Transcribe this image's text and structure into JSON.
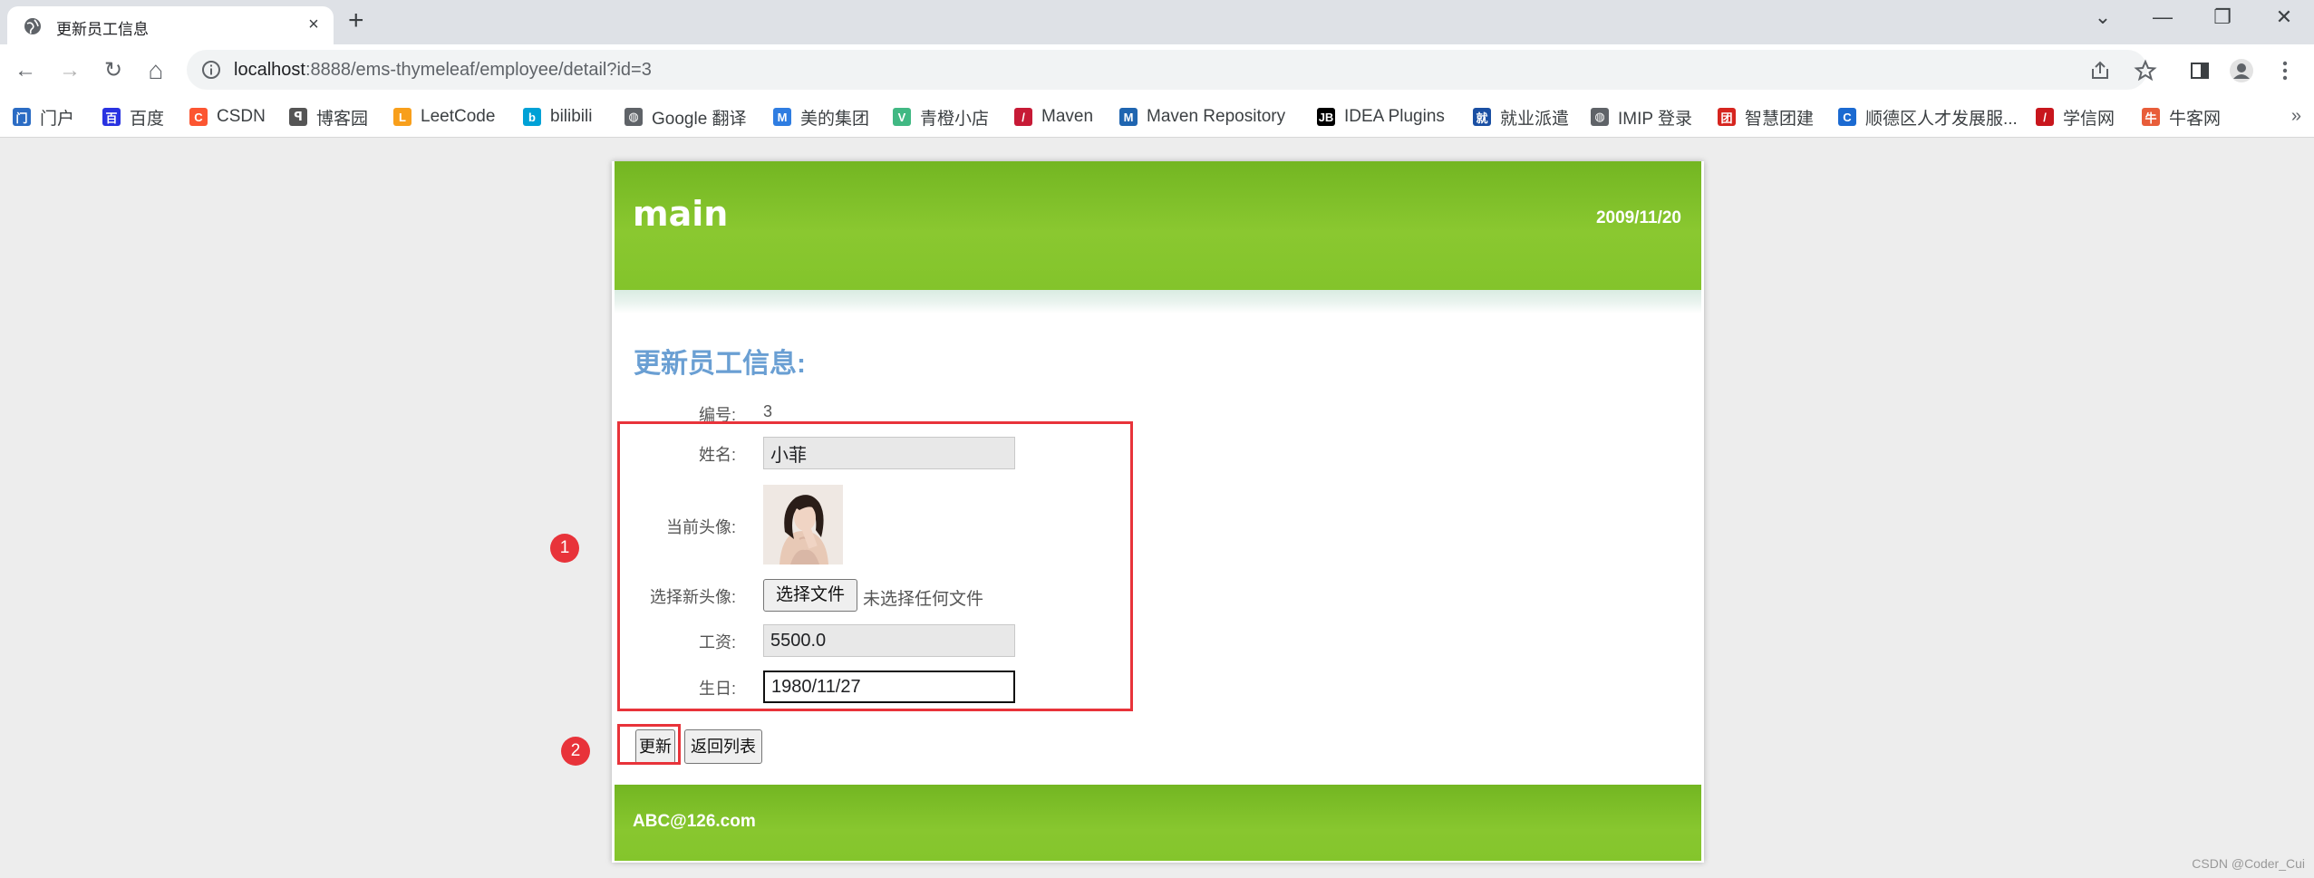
{
  "browser": {
    "tab_title": "更新员工信息",
    "tab_close": "×",
    "new_tab": "+",
    "window_controls": [
      "⌄",
      "—",
      "❐",
      "✕"
    ],
    "url_host": "localhost",
    "url_path": ":8888/ems-thymeleaf/employee/detail?id=3",
    "nav": {
      "back": "←",
      "forward": "→",
      "reload": "↻",
      "home": "⌂"
    },
    "toolbar_icons": [
      "share-icon",
      "star-icon",
      "sidepanel-icon",
      "profile-icon",
      "menu-icon"
    ]
  },
  "bookmarks": [
    {
      "label": "门户",
      "icon": "portal-icon",
      "color": "#2b6cc4",
      "glyph": "门"
    },
    {
      "label": "百度",
      "icon": "baidu-icon",
      "color": "#2932e1",
      "glyph": "百"
    },
    {
      "label": "CSDN",
      "icon": "csdn-icon",
      "color": "#fc5531",
      "glyph": "C"
    },
    {
      "label": "博客园",
      "icon": "cnblogs-icon",
      "color": "#555555",
      "glyph": "ꟼ"
    },
    {
      "label": "LeetCode",
      "icon": "leetcode-icon",
      "color": "#f89f1b",
      "glyph": "L"
    },
    {
      "label": "bilibili",
      "icon": "bilibili-icon",
      "color": "#00a1d6",
      "glyph": "b"
    },
    {
      "label": "Google 翻译",
      "icon": "globe-icon",
      "color": "#5f6368",
      "glyph": "◍"
    },
    {
      "label": "美的集团",
      "icon": "midea-icon",
      "color": "#2f7de1",
      "glyph": "M"
    },
    {
      "label": "青橙小店",
      "icon": "vue-icon",
      "color": "#41b883",
      "glyph": "V"
    },
    {
      "label": "Maven",
      "icon": "maven-icon",
      "color": "#c71a36",
      "glyph": "/"
    },
    {
      "label": "Maven Repository",
      "icon": "mvn-icon",
      "color": "#1f65b0",
      "glyph": "M"
    },
    {
      "label": "IDEA Plugins",
      "icon": "jetbrains-icon",
      "color": "#000000",
      "glyph": "JB"
    },
    {
      "label": "就业派遣",
      "icon": "graduate-icon",
      "color": "#1a4fa3",
      "glyph": "就"
    },
    {
      "label": "IMIP 登录",
      "icon": "globe-icon",
      "color": "#5f6368",
      "glyph": "◍"
    },
    {
      "label": "智慧团建",
      "icon": "league-icon",
      "color": "#d6251f",
      "glyph": "团"
    },
    {
      "label": "顺德区人才发展服...",
      "icon": "shunde-icon",
      "color": "#1b6ad1",
      "glyph": "C"
    },
    {
      "label": "学信网",
      "icon": "chsi-icon",
      "color": "#c8161d",
      "glyph": "/"
    },
    {
      "label": "牛客网",
      "icon": "nowcoder-icon",
      "color": "#e85d3a",
      "glyph": "牛"
    }
  ],
  "bookmarks_more": "»",
  "app": {
    "brand": "main",
    "date": "2009/11/20",
    "heading": "更新员工信息:",
    "footer_email": "ABC@126.com"
  },
  "form": {
    "id_label": "编号:",
    "id_value": "3",
    "name_label": "姓名:",
    "name_value": "小菲",
    "avatar_label": "当前头像:",
    "new_avatar_label": "选择新头像:",
    "file_button": "选择文件",
    "file_status": "未选择任何文件",
    "salary_label": "工资:",
    "salary_value": "5500.0",
    "birthday_label": "生日:",
    "birthday_value": "1980/11/27",
    "update_button": "更新",
    "back_button": "返回列表"
  },
  "annotations": {
    "marker_1": "1",
    "marker_2": "2",
    "accent_color": "#e8333a"
  },
  "watermark": "CSDN @Coder_Cui"
}
